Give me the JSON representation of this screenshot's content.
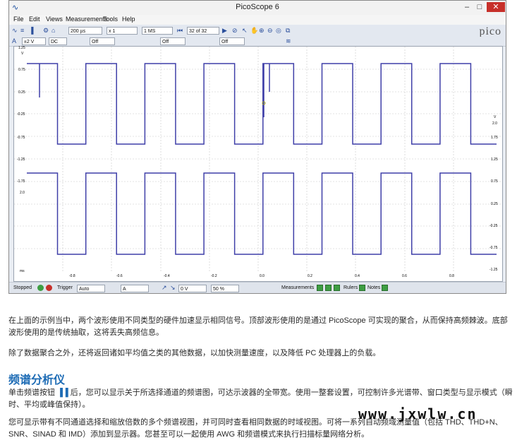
{
  "window": {
    "title": "PicoScope 6",
    "logo": "pico"
  },
  "menu": [
    "File",
    "Edit",
    "Views",
    "Measurements",
    "Tools",
    "Help"
  ],
  "toolbar1": {
    "timebase": "200 µs",
    "zoom": "x 1",
    "samples": "1 MS",
    "buffer": "32 of 32"
  },
  "toolbar2": {
    "chA_range": "±2 V",
    "chA_coupling": "DC",
    "chA_filter": "Off",
    "chB_filter": "Off",
    "chB_coupling_off": "Off"
  },
  "plot": {
    "left_axis_unit": "V",
    "left_ticks_top": [
      "1.25",
      "0.75",
      "0.25",
      "-0.25",
      "-0.75",
      "-1.25",
      "-1.75"
    ],
    "left_ticks_bottom": [
      "2.0"
    ],
    "right_axis_unit": "V",
    "right_ticks": [
      "2.0",
      "1.75",
      "1.25",
      "0.75",
      "0.25",
      "-0.25",
      "-0.75",
      "-1.25"
    ],
    "x_ticks": [
      "-0.8",
      "-0.6",
      "-0.4",
      "-0.2",
      "0.0",
      "0.2",
      "0.4",
      "0.6",
      "0.8"
    ],
    "x_unit": "ms",
    "trace_color": "#3f3fa8"
  },
  "statusbar": {
    "state": "Stopped",
    "trigger_label": "Trigger",
    "trigger_mode": "Auto",
    "trigger_channel": "A",
    "level": "0 V",
    "percent": "50 %",
    "measurements": "Measurements",
    "rulers": "Rulers",
    "notes": "Notes"
  },
  "article": {
    "p1": "在上面的示例当中，两个波形使用不同类型的硬件加速显示相同信号。顶部波形使用的是通过 PicoScope 可实现的聚合，从而保持高频棘波。底部波形使用的是传统抽取，这将丢失高频信息。",
    "p2": "除了数据聚合之外，还将返回诸如平均值之类的其他数据，以加快测量速度，以及降低 PC 处理器上的负载。",
    "heading": "频谱分析仪",
    "p3a": "单击频谱按钮",
    "p3b": "后，您可以显示关于所选择通道的频谱图，可达示波器的全带宽。使用一整套设置，可控制许多光谱带、窗口类型与显示模式（瞬时、平均或峰值保持）。",
    "p4": "您可显示带有不同通道选择和缩放倍数的多个频谱视图，并可同时查看相同数据的时域视图。可将一系列自动频域测量值（包括 THD、THD+N、SNR、SINAD 和 IMD）添加到显示器。您甚至可以一起使用 AWG 和频谱模式来执行扫描标量网络分析。",
    "watermark_logo": "www.jxwlw.cn"
  }
}
